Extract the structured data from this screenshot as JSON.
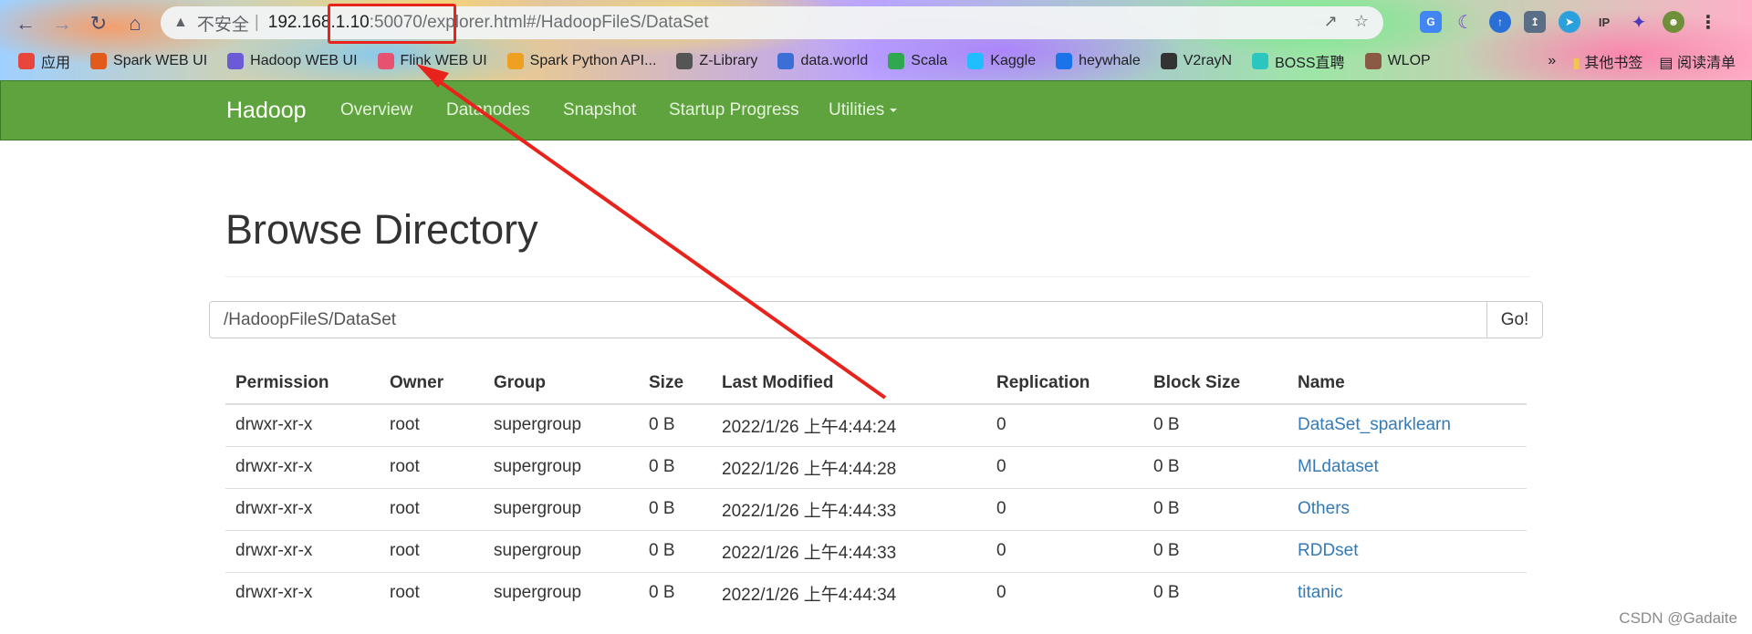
{
  "browser": {
    "security_label": "不安全",
    "url_host": "192.168.1.10",
    "url_path": ":50070/explorer.html#/HadoopFileS/DataSet",
    "bookmarks": [
      {
        "label": "应用",
        "icon": "apps-grid-icon",
        "color": "#e8453c"
      },
      {
        "label": "Spark WEB UI",
        "icon": "spark-icon",
        "color": "#e25a1c"
      },
      {
        "label": "Hadoop WEB UI",
        "icon": "hadoop-icon",
        "color": "#6b5bd6"
      },
      {
        "label": "Flink WEB UI",
        "icon": "flink-icon",
        "color": "#e6526f"
      },
      {
        "label": "Spark Python API...",
        "icon": "star-icon",
        "color": "#f0a020"
      },
      {
        "label": "Z-Library",
        "icon": "zlibrary-icon",
        "color": "#555555"
      },
      {
        "label": "data.world",
        "icon": "dataworld-icon",
        "color": "#3b6fd6"
      },
      {
        "label": "Scala",
        "icon": "scala-icon",
        "color": "#2fa84f"
      },
      {
        "label": "Kaggle",
        "icon": "kaggle-icon",
        "color": "#20beff"
      },
      {
        "label": "heywhale",
        "icon": "heywhale-icon",
        "color": "#1a73e8"
      },
      {
        "label": "V2rayN",
        "icon": "github-icon",
        "color": "#333333"
      },
      {
        "label": "BOSS直聘",
        "icon": "boss-icon",
        "color": "#2bc6c0"
      },
      {
        "label": "WLOP",
        "icon": "wlop-icon",
        "color": "#8a5a44"
      }
    ],
    "bookmarks_overflow": "»",
    "other_bookmarks": "其他书签",
    "reading_list": "阅读清单"
  },
  "navbar": {
    "brand": "Hadoop",
    "items": [
      "Overview",
      "Datanodes",
      "Snapshot",
      "Startup Progress",
      "Utilities"
    ]
  },
  "main": {
    "title": "Browse Directory",
    "path_value": "/HadoopFileS/DataSet",
    "go_label": "Go!",
    "columns": [
      "Permission",
      "Owner",
      "Group",
      "Size",
      "Last Modified",
      "Replication",
      "Block Size",
      "Name"
    ],
    "rows": [
      {
        "permission": "drwxr-xr-x",
        "owner": "root",
        "group": "supergroup",
        "size": "0 B",
        "modified": "2022/1/26 上午4:44:24",
        "replication": "0",
        "block_size": "0 B",
        "name": "DataSet_sparklearn"
      },
      {
        "permission": "drwxr-xr-x",
        "owner": "root",
        "group": "supergroup",
        "size": "0 B",
        "modified": "2022/1/26 上午4:44:28",
        "replication": "0",
        "block_size": "0 B",
        "name": "MLdataset"
      },
      {
        "permission": "drwxr-xr-x",
        "owner": "root",
        "group": "supergroup",
        "size": "0 B",
        "modified": "2022/1/26 上午4:44:33",
        "replication": "0",
        "block_size": "0 B",
        "name": "Others"
      },
      {
        "permission": "drwxr-xr-x",
        "owner": "root",
        "group": "supergroup",
        "size": "0 B",
        "modified": "2022/1/26 上午4:44:33",
        "replication": "0",
        "block_size": "0 B",
        "name": "RDDset"
      },
      {
        "permission": "drwxr-xr-x",
        "owner": "root",
        "group": "supergroup",
        "size": "0 B",
        "modified": "2022/1/26 上午4:44:34",
        "replication": "0",
        "block_size": "0 B",
        "name": "titanic"
      }
    ]
  },
  "colors": {
    "navbar": "#5fa33e",
    "link": "#337ab7",
    "annotation": "#e8231c"
  },
  "watermark": "CSDN @Gadaite"
}
